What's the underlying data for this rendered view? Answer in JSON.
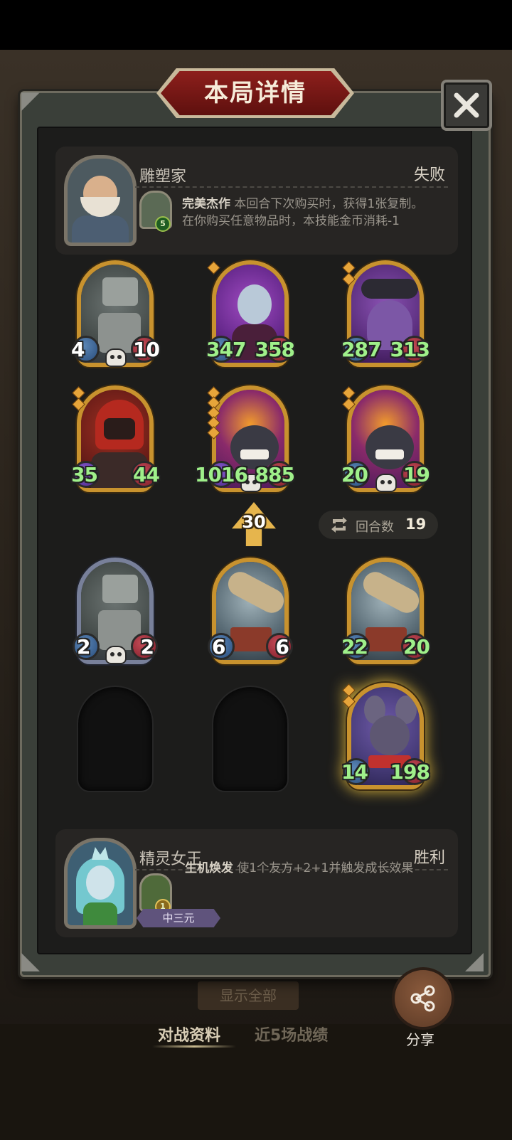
{
  "dialog": {
    "title": "本局详情"
  },
  "player_top": {
    "name": "雕塑家",
    "result": "失败",
    "skill_cost": "5",
    "skill_name": "完美杰作",
    "skill_desc_line1": "本回合下次购买时，获得1张复制。",
    "skill_desc_line2": "在你购买任意物品时，本技能金币消耗-1"
  },
  "board_top": [
    {
      "atk": "4",
      "hp": "10",
      "tier": 0,
      "art": "robot",
      "frame": "gold"
    },
    {
      "atk": "347",
      "hp": "358",
      "tier": 1,
      "art": "elf",
      "frame": "gold"
    },
    {
      "atk": "287",
      "hp": "313",
      "tier": 2,
      "art": "octo",
      "frame": "gold"
    },
    {
      "atk": "35",
      "hp": "44",
      "tier": 2,
      "art": "rogue",
      "frame": "gold"
    },
    {
      "atk": "1016",
      "hp": "885",
      "tier": 5,
      "art": "bomb",
      "frame": "gold"
    },
    {
      "atk": "20",
      "hp": "19",
      "tier": 2,
      "art": "bomb",
      "frame": "gold"
    }
  ],
  "round_info": {
    "level": "30",
    "round_label": "回合数",
    "round_value": "19"
  },
  "board_bottom": [
    {
      "atk": "2",
      "hp": "2",
      "art": "robot",
      "frame": "silver"
    },
    {
      "atk": "6",
      "hp": "6",
      "art": "blimp",
      "frame": "gold"
    },
    {
      "atk": "22",
      "hp": "20",
      "art": "blimp",
      "frame": "gold"
    },
    {
      "atk": "14",
      "hp": "198",
      "art": "rat",
      "frame": "gold"
    }
  ],
  "player_bottom": {
    "name": "精灵女王",
    "result": "胜利",
    "skill_cost": "1",
    "skill_name": "生机焕发",
    "skill_desc": "使1个友方+2+1并触发成长效果",
    "rank": "中三元"
  },
  "footer": {
    "show_all": "显示全部",
    "tab_active": "对战资料",
    "tab_inactive": "近5场战绩",
    "share_label": "分享"
  },
  "colors": {
    "accent_red": "#8d1f1c",
    "gold_frame": "#c8922e",
    "stat_green": "#9ff08a"
  }
}
